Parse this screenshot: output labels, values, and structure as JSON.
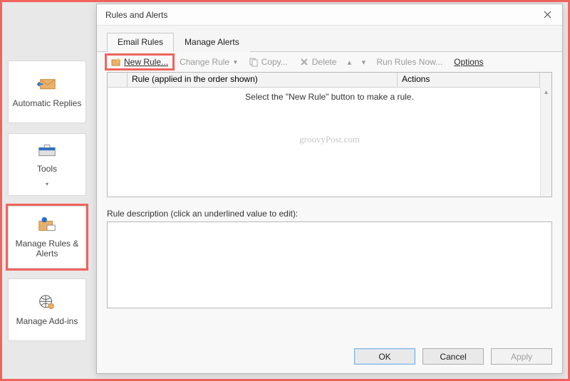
{
  "nav": {
    "auto_replies": "Automatic Replies",
    "tools": "Tools",
    "manage_rules": "Manage Rules & Alerts",
    "manage_addins": "Manage Add-ins"
  },
  "dialog": {
    "title": "Rules and Alerts",
    "tabs": {
      "email_rules": "Email Rules",
      "manage_alerts": "Manage Alerts"
    },
    "toolbar": {
      "new_rule": "New Rule...",
      "change_rule": "Change Rule",
      "copy": "Copy...",
      "delete": "Delete",
      "run_rules_now": "Run Rules Now...",
      "options": "Options"
    },
    "grid": {
      "col_rule": "Rule (applied in the order shown)",
      "col_actions": "Actions",
      "empty_msg": "Select the \"New Rule\" button to make a rule."
    },
    "watermark": "groovyPost.com",
    "desc_label": "Rule description (click an underlined value to edit):",
    "buttons": {
      "ok": "OK",
      "cancel": "Cancel",
      "apply": "Apply"
    }
  }
}
